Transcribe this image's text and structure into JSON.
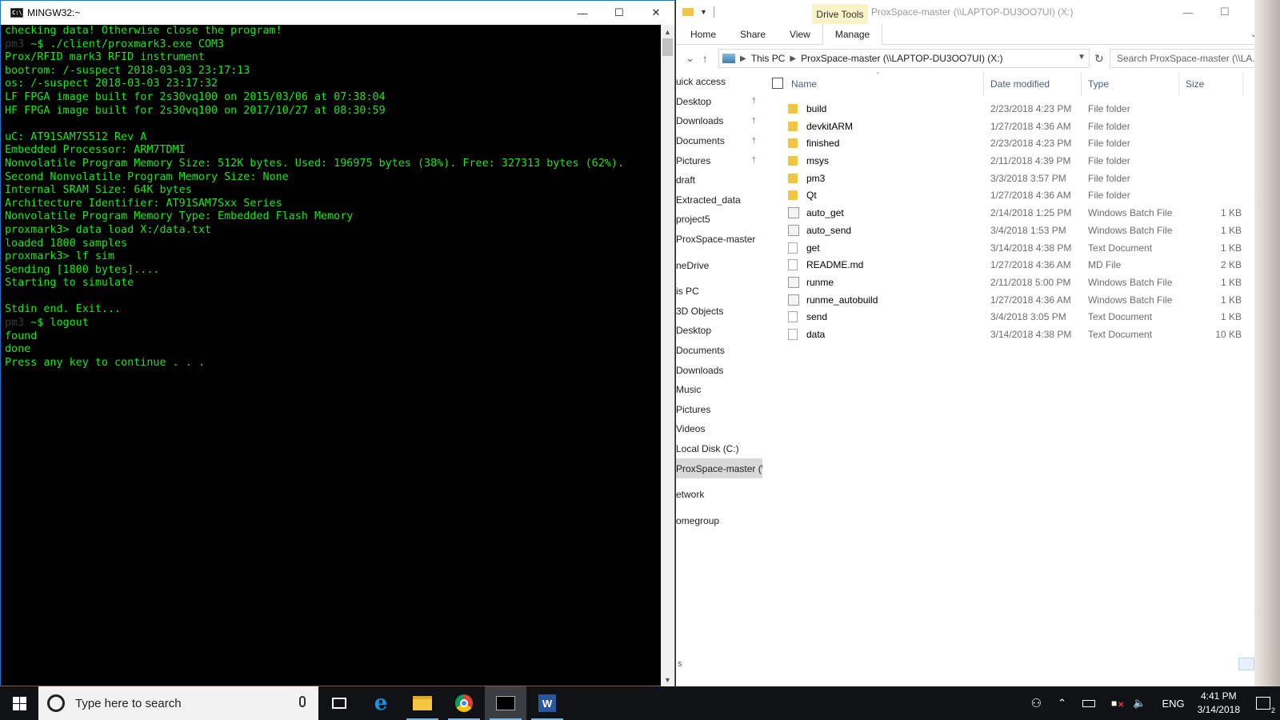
{
  "terminal": {
    "title": "MINGW32:~",
    "icon_text": "C:\\",
    "lines": [
      {
        "prefix": "",
        "text": "checking data! Otherwise close the program!"
      },
      {
        "prefix": "pm3",
        "text": " ~$ ./client/proxmark3.exe COM3"
      },
      {
        "prefix": "",
        "text": "Prox/RFID mark3 RFID instrument"
      },
      {
        "prefix": "",
        "text": "bootrom: /-suspect 2018-03-03 23:17:13"
      },
      {
        "prefix": "",
        "text": "os: /-suspect 2018-03-03 23:17:32"
      },
      {
        "prefix": "",
        "text": "LF FPGA image built for 2s30vq100 on 2015/03/06 at 07:38:04"
      },
      {
        "prefix": "",
        "text": "HF FPGA image built for 2s30vq100 on 2017/10/27 at 08:30:59"
      },
      {
        "prefix": "",
        "text": ""
      },
      {
        "prefix": "",
        "text": "uC: AT91SAM7S512 Rev A"
      },
      {
        "prefix": "",
        "text": "Embedded Processor: ARM7TDMI"
      },
      {
        "prefix": "",
        "text": "Nonvolatile Program Memory Size: 512K bytes. Used: 196975 bytes (38%). Free: 327313 bytes (62%)."
      },
      {
        "prefix": "",
        "text": "Second Nonvolatile Program Memory Size: None"
      },
      {
        "prefix": "",
        "text": "Internal SRAM Size: 64K bytes"
      },
      {
        "prefix": "",
        "text": "Architecture Identifier: AT91SAM7Sxx Series"
      },
      {
        "prefix": "",
        "text": "Nonvolatile Program Memory Type: Embedded Flash Memory"
      },
      {
        "prefix": "",
        "text": "proxmark3> data load X:/data.txt"
      },
      {
        "prefix": "",
        "text": "loaded 1800 samples"
      },
      {
        "prefix": "",
        "text": "proxmark3> lf sim"
      },
      {
        "prefix": "",
        "text": "Sending [1800 bytes]...."
      },
      {
        "prefix": "",
        "text": "Starting to simulate"
      },
      {
        "prefix": "",
        "text": ""
      },
      {
        "prefix": "",
        "text": "Stdin end. Exit..."
      },
      {
        "prefix": "pm3",
        "text": " ~$ logout"
      },
      {
        "prefix": "",
        "text": "found"
      },
      {
        "prefix": "",
        "text": "done"
      },
      {
        "prefix": "",
        "text": "Press any key to continue . . ."
      }
    ]
  },
  "explorer": {
    "context_tab": "Drive Tools",
    "title": "ProxSpace-master (\\\\LAPTOP-DU3OO7UI) (X:)",
    "ribbon_tabs": [
      "Home",
      "Share",
      "View",
      "Manage"
    ],
    "breadcrumb": [
      "This PC",
      "ProxSpace-master (\\\\LAPTOP-DU3OO7UI) (X:)"
    ],
    "search_placeholder": "Search ProxSpace-master (\\\\LA...",
    "columns": {
      "name": "Name",
      "date": "Date modified",
      "type": "Type",
      "size": "Size"
    },
    "nav_items": [
      {
        "label": "uick access",
        "pin": false
      },
      {
        "label": "Desktop",
        "pin": true
      },
      {
        "label": "Downloads",
        "pin": true
      },
      {
        "label": "Documents",
        "pin": true
      },
      {
        "label": "Pictures",
        "pin": true
      },
      {
        "label": "draft",
        "pin": false
      },
      {
        "label": "Extracted_data",
        "pin": false
      },
      {
        "label": "project5",
        "pin": false
      },
      {
        "label": "ProxSpace-master",
        "pin": false
      },
      {
        "label": "",
        "pin": false
      },
      {
        "label": "neDrive",
        "pin": false
      },
      {
        "label": "",
        "pin": false
      },
      {
        "label": "is PC",
        "pin": false
      },
      {
        "label": "3D Objects",
        "pin": false
      },
      {
        "label": "Desktop",
        "pin": false
      },
      {
        "label": "Documents",
        "pin": false
      },
      {
        "label": "Downloads",
        "pin": false
      },
      {
        "label": "Music",
        "pin": false
      },
      {
        "label": "Pictures",
        "pin": false
      },
      {
        "label": "Videos",
        "pin": false
      },
      {
        "label": "Local Disk (C:)",
        "pin": false
      },
      {
        "label": "ProxSpace-master (\\",
        "pin": false,
        "selected": true
      },
      {
        "label": "",
        "pin": false
      },
      {
        "label": "etwork",
        "pin": false
      },
      {
        "label": "",
        "pin": false
      },
      {
        "label": "omegroup",
        "pin": false
      }
    ],
    "files": [
      {
        "name": "build",
        "date": "2/23/2018 4:23 PM",
        "type": "File folder",
        "size": "",
        "icon": "folder-icon"
      },
      {
        "name": "devkitARM",
        "date": "1/27/2018 4:36 AM",
        "type": "File folder",
        "size": "",
        "icon": "folder-icon"
      },
      {
        "name": "finished",
        "date": "2/23/2018 4:23 PM",
        "type": "File folder",
        "size": "",
        "icon": "folder-icon"
      },
      {
        "name": "msys",
        "date": "2/11/2018 4:39 PM",
        "type": "File folder",
        "size": "",
        "icon": "folder-icon"
      },
      {
        "name": "pm3",
        "date": "3/3/2018 3:57 PM",
        "type": "File folder",
        "size": "",
        "icon": "folder-icon"
      },
      {
        "name": "Qt",
        "date": "1/27/2018 4:36 AM",
        "type": "File folder",
        "size": "",
        "icon": "folder-icon"
      },
      {
        "name": "auto_get",
        "date": "2/14/2018 1:25 PM",
        "type": "Windows Batch File",
        "size": "1 KB",
        "icon": "batch-file-icon"
      },
      {
        "name": "auto_send",
        "date": "3/4/2018 1:53 PM",
        "type": "Windows Batch File",
        "size": "1 KB",
        "icon": "batch-file-icon"
      },
      {
        "name": "get",
        "date": "3/14/2018 4:38 PM",
        "type": "Text Document",
        "size": "1 KB",
        "icon": "text-file-icon"
      },
      {
        "name": "README.md",
        "date": "1/27/2018 4:36 AM",
        "type": "MD File",
        "size": "2 KB",
        "icon": "text-file-icon"
      },
      {
        "name": "runme",
        "date": "2/11/2018 5:00 PM",
        "type": "Windows Batch File",
        "size": "1 KB",
        "icon": "batch-file-icon"
      },
      {
        "name": "runme_autobuild",
        "date": "1/27/2018 4:36 AM",
        "type": "Windows Batch File",
        "size": "1 KB",
        "icon": "batch-file-icon"
      },
      {
        "name": "send",
        "date": "3/4/2018 3:05 PM",
        "type": "Text Document",
        "size": "1 KB",
        "icon": "text-file-icon"
      },
      {
        "name": "data",
        "date": "3/14/2018 4:38 PM",
        "type": "Text Document",
        "size": "10 KB",
        "icon": "text-file-icon"
      }
    ],
    "status_partial": "s"
  },
  "taskbar": {
    "search_placeholder": "Type here to search",
    "language": "ENG",
    "time": "4:41 PM",
    "date": "3/14/2018",
    "notification_count": "2",
    "word_letter": "W"
  },
  "colors": {
    "terminal_text": "#1ee41e",
    "terminal_bg": "#000000",
    "accent": "#1e74c9",
    "drive_tools_bg": "#f8f4c7"
  }
}
